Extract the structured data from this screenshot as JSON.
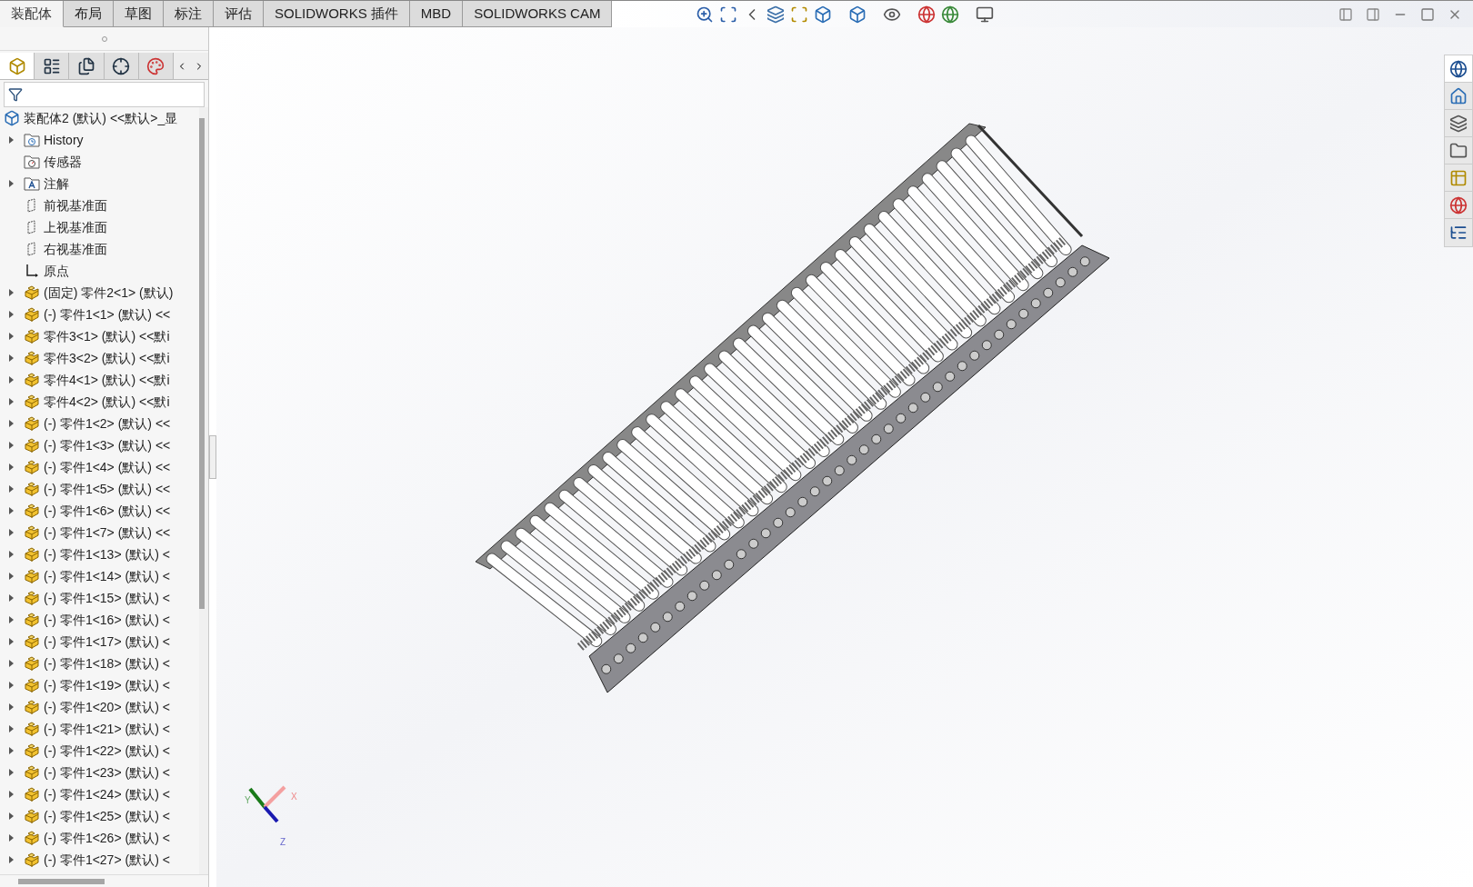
{
  "command_tabs": [
    {
      "label": "装配体",
      "selected": true
    },
    {
      "label": "布局",
      "selected": false
    },
    {
      "label": "草图",
      "selected": false
    },
    {
      "label": "标注",
      "selected": false
    },
    {
      "label": "评估",
      "selected": false
    },
    {
      "label": "SOLIDWORKS 插件",
      "selected": false
    },
    {
      "label": "MBD",
      "selected": false
    },
    {
      "label": "SOLIDWORKS CAM",
      "selected": false
    }
  ],
  "manager_tabs": [
    {
      "kind": "tree",
      "selected": true
    },
    {
      "kind": "property",
      "selected": false
    },
    {
      "kind": "config",
      "selected": false
    },
    {
      "kind": "dim",
      "selected": false
    },
    {
      "kind": "display",
      "selected": false
    }
  ],
  "tree": {
    "root": "装配体2 (默认) <<默认>_显",
    "items": [
      {
        "kind": "history",
        "label": "History",
        "expandable": true
      },
      {
        "kind": "sensor",
        "label": "传感器",
        "expandable": false
      },
      {
        "kind": "annotation",
        "label": "注解",
        "expandable": true
      },
      {
        "kind": "plane",
        "label": "前视基准面",
        "expandable": false
      },
      {
        "kind": "plane",
        "label": "上视基准面",
        "expandable": false
      },
      {
        "kind": "plane",
        "label": "右视基准面",
        "expandable": false
      },
      {
        "kind": "origin",
        "label": "原点",
        "expandable": false
      },
      {
        "kind": "part",
        "label": "(固定) 零件2<1> (默认)",
        "expandable": true
      },
      {
        "kind": "part",
        "label": "(-) 零件1<1> (默认) <<",
        "expandable": true
      },
      {
        "kind": "part",
        "label": "零件3<1> (默认) <<默i",
        "expandable": true
      },
      {
        "kind": "part",
        "label": "零件3<2> (默认) <<默i",
        "expandable": true
      },
      {
        "kind": "part",
        "label": "零件4<1> (默认) <<默i",
        "expandable": true
      },
      {
        "kind": "part",
        "label": "零件4<2> (默认) <<默i",
        "expandable": true
      },
      {
        "kind": "part",
        "label": "(-) 零件1<2> (默认) <<",
        "expandable": true
      },
      {
        "kind": "part",
        "label": "(-) 零件1<3> (默认) <<",
        "expandable": true
      },
      {
        "kind": "part",
        "label": "(-) 零件1<4> (默认) <<",
        "expandable": true
      },
      {
        "kind": "part",
        "label": "(-) 零件1<5> (默认) <<",
        "expandable": true
      },
      {
        "kind": "part",
        "label": "(-) 零件1<6> (默认) <<",
        "expandable": true
      },
      {
        "kind": "part",
        "label": "(-) 零件1<7> (默认) <<",
        "expandable": true
      },
      {
        "kind": "part",
        "label": "(-) 零件1<13> (默认) <",
        "expandable": true
      },
      {
        "kind": "part",
        "label": "(-) 零件1<14> (默认) <",
        "expandable": true
      },
      {
        "kind": "part",
        "label": "(-) 零件1<15> (默认) <",
        "expandable": true
      },
      {
        "kind": "part",
        "label": "(-) 零件1<16> (默认) <",
        "expandable": true
      },
      {
        "kind": "part",
        "label": "(-) 零件1<17> (默认) <",
        "expandable": true
      },
      {
        "kind": "part",
        "label": "(-) 零件1<18> (默认) <",
        "expandable": true
      },
      {
        "kind": "part",
        "label": "(-) 零件1<19> (默认) <",
        "expandable": true
      },
      {
        "kind": "part",
        "label": "(-) 零件1<20> (默认) <",
        "expandable": true
      },
      {
        "kind": "part",
        "label": "(-) 零件1<21> (默认) <",
        "expandable": true
      },
      {
        "kind": "part",
        "label": "(-) 零件1<22> (默认) <",
        "expandable": true
      },
      {
        "kind": "part",
        "label": "(-) 零件1<23> (默认) <",
        "expandable": true
      },
      {
        "kind": "part",
        "label": "(-) 零件1<24> (默认) <",
        "expandable": true
      },
      {
        "kind": "part",
        "label": "(-) 零件1<25> (默认) <",
        "expandable": true
      },
      {
        "kind": "part",
        "label": "(-) 零件1<26> (默认) <",
        "expandable": true
      },
      {
        "kind": "part",
        "label": "(-) 零件1<27> (默认) <",
        "expandable": true
      }
    ]
  },
  "triad": {
    "x": "X",
    "y": "Y",
    "z": "Z"
  }
}
